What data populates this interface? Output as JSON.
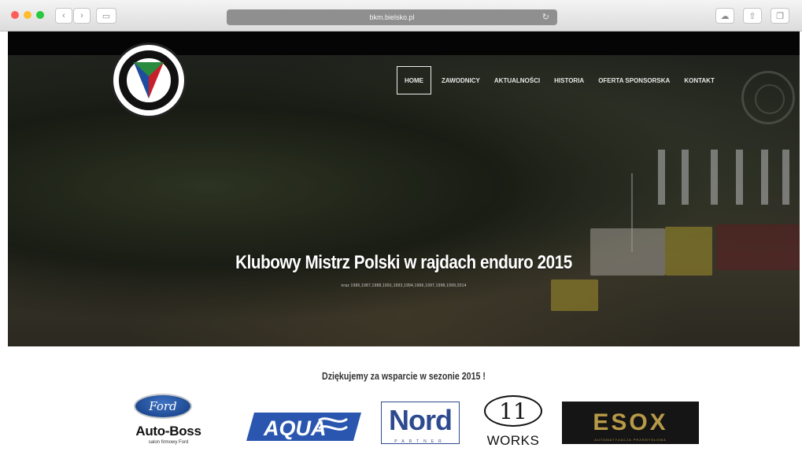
{
  "browser": {
    "url": "bkm.bielsko.pl",
    "traffic_lights": [
      "#fd5f57",
      "#febc2e",
      "#28c840"
    ],
    "back_icon": "chevron-left-icon",
    "forward_icon": "chevron-right-icon",
    "sidebar_icon": "sidebar-icon",
    "reload_icon": "reload-icon",
    "right_icons": [
      "cloud-icon",
      "share-icon",
      "tabs-icon"
    ]
  },
  "site": {
    "nav": [
      {
        "label": "HOME",
        "active": true
      },
      {
        "label": "ZAWODNICY",
        "active": false
      },
      {
        "label": "AKTUALNOŚCI",
        "active": false
      },
      {
        "label": "HISTORIA",
        "active": false
      },
      {
        "label": "OFERTA SPONSORSKA",
        "active": false
      },
      {
        "label": "KONTAKT",
        "active": false
      }
    ],
    "hero": {
      "headline": "Klubowy Mistrz Polski w rajdach enduro 2015",
      "subline": "oraz 1986,1987,1988,1991,1993,1994,1996,1997,1998,1999,2014"
    },
    "thanks": "Dziękujemy za wsparcie w sezonie 2015 !",
    "sponsors": {
      "ford": {
        "oval": "Ford",
        "name": "Auto-Boss",
        "tagline": "salon firmowy Ford"
      },
      "aqua": {
        "name": "AQUA"
      },
      "nord": {
        "name": "Nord",
        "sub": "PARTNER"
      },
      "works": {
        "number": "11",
        "name": "WORKS"
      },
      "esox": {
        "name": "ESOX",
        "sub": "AUTOMATYZACJA PRZEMYSŁOWA"
      }
    },
    "colors": {
      "accent_blue": "#2e4a8f",
      "esox_gold": "#b79a47"
    }
  }
}
